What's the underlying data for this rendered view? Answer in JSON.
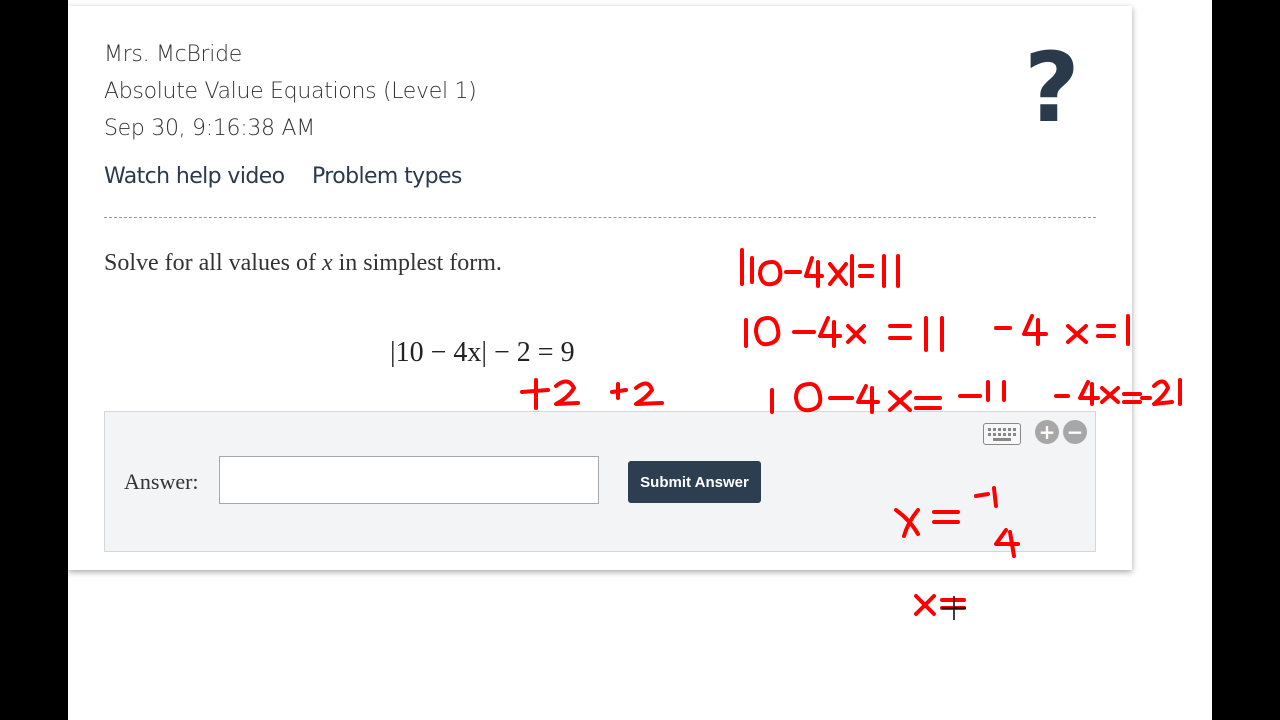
{
  "header": {
    "teacher": "Mrs. McBride",
    "assignment": "Absolute Value Equations (Level 1)",
    "timestamp": "Sep 30, 9:16:38 AM"
  },
  "help_icon_glyph": "?",
  "links": {
    "help_video": "Watch help video",
    "problem_types": "Problem types"
  },
  "problem": {
    "prompt_before": "Solve for all values of",
    "variable": "x",
    "prompt_after": "in simplest form.",
    "equation": "|10 − 4x| − 2 = 9"
  },
  "answer": {
    "label": "Answer:",
    "value": "",
    "placeholder": "",
    "submit_label": "Submit Answer"
  },
  "answer_tools": {
    "zoom_in": "+",
    "zoom_out": "−",
    "icons": [
      "keyboard-icon",
      "zoom-in-icon",
      "zoom-out-icon"
    ]
  },
  "annotations": {
    "ink_color": "#ff0000",
    "lines": [
      "+2 +2",
      "|10-4x|=11",
      "10-4x=11",
      "-4x=1",
      "10-4x=-11",
      "-4x=-21",
      "x=-1/4",
      "x="
    ]
  },
  "colors": {
    "button_bg": "#2c3e50",
    "ink": "#ff0000",
    "link_color": "#2b3a4b"
  }
}
